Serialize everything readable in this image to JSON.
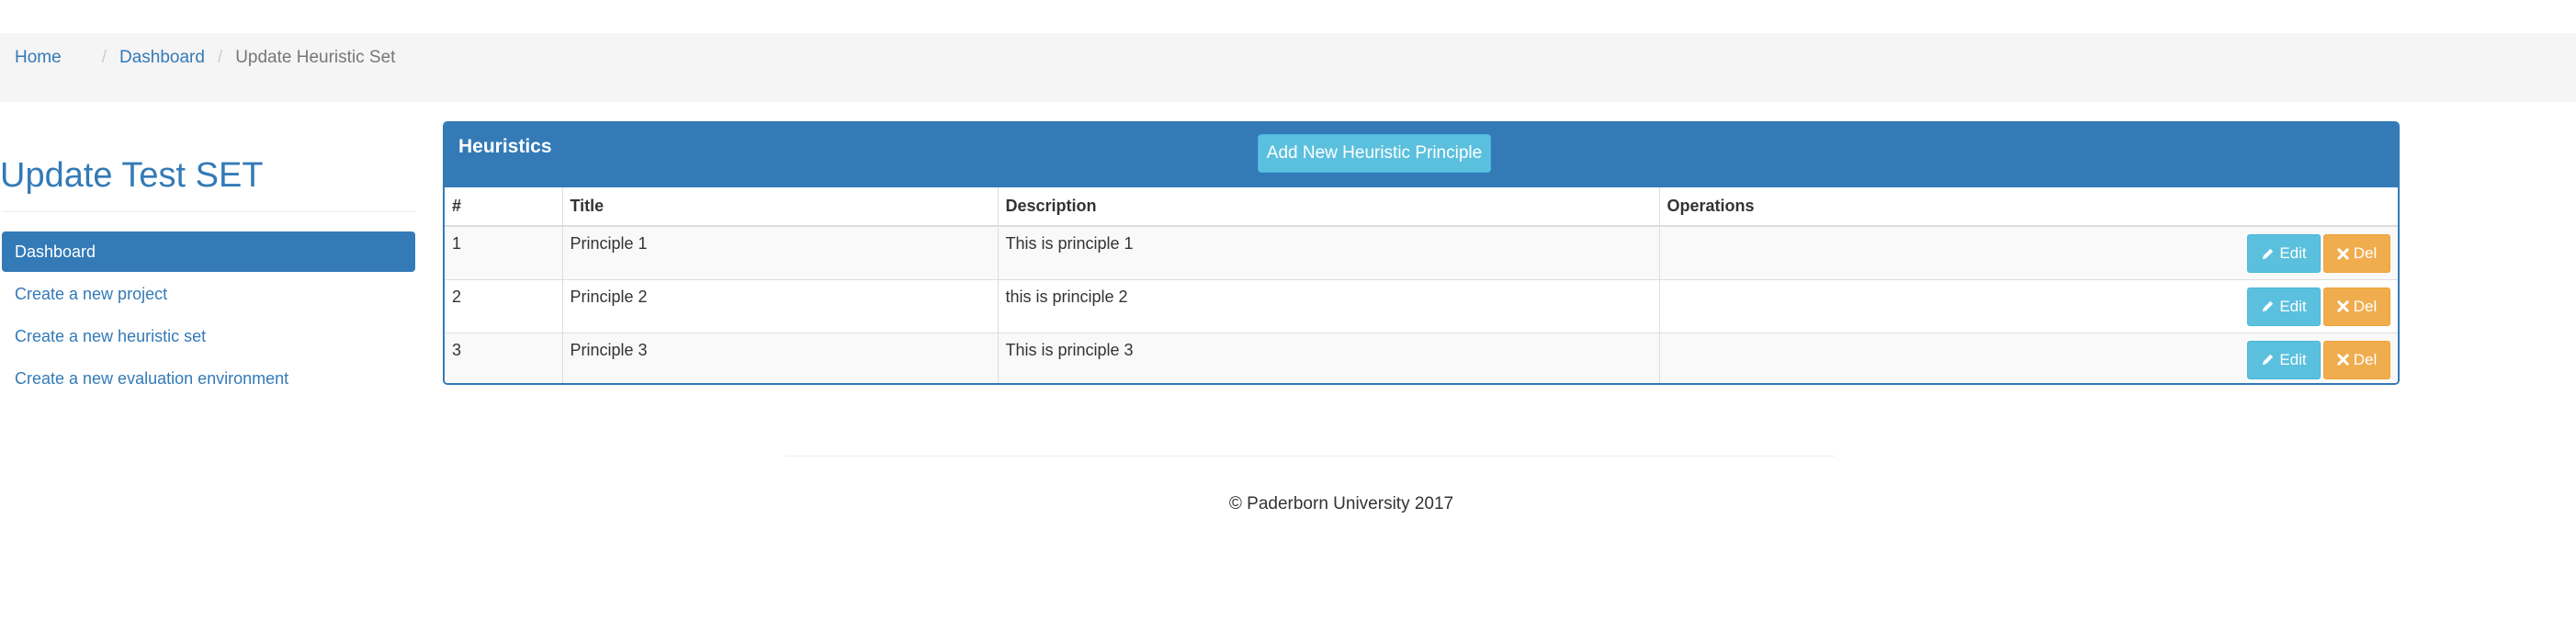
{
  "breadcrumb": {
    "home": "Home",
    "dashboard": "Dashboard",
    "current": "Update Heuristic Set",
    "separator": "/"
  },
  "page": {
    "title": "Update Test SET"
  },
  "sidebar": {
    "items": [
      {
        "label": "Dashboard",
        "active": true
      },
      {
        "label": "Create a new project",
        "active": false
      },
      {
        "label": "Create a new heuristic set",
        "active": false
      },
      {
        "label": "Create a new evaluation environment",
        "active": false
      }
    ]
  },
  "panel": {
    "title": "Heuristics",
    "add_button": "Add New Heuristic Principle",
    "columns": [
      "#",
      "Title",
      "Description",
      "Operations"
    ],
    "rows": [
      {
        "num": "1",
        "title": "Principle 1",
        "description": "This is principle 1"
      },
      {
        "num": "2",
        "title": "Principle 2",
        "description": "this is principle 2"
      },
      {
        "num": "3",
        "title": "Principle 3",
        "description": "This is principle 3"
      }
    ],
    "edit_label": "Edit",
    "delete_label": "Del"
  },
  "footer": {
    "text": "© Paderborn University 2017"
  },
  "colors": {
    "primary": "#337ab7",
    "info": "#5bc0de",
    "warning": "#f0ad4e",
    "breadcrumb_bg": "#f5f5f5"
  },
  "icons": {
    "edit": "pencil-icon",
    "delete": "x-icon"
  }
}
